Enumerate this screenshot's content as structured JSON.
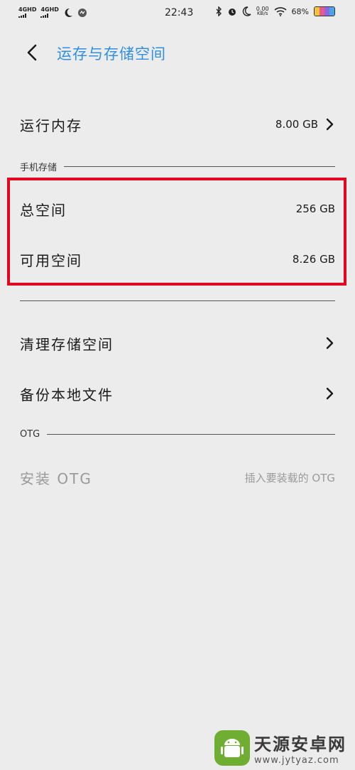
{
  "status_bar": {
    "net1": "4GHD",
    "net2": "4GHD",
    "time": "22:43",
    "speed_value": "0.00",
    "speed_unit": "KB/s",
    "battery": "68%",
    "battery_level": 0.68
  },
  "header": {
    "title": "运存与存储空间"
  },
  "ram": {
    "label": "运行内存",
    "value": "8.00 GB"
  },
  "phone_storage": {
    "section_title": "手机存储",
    "total_label": "总空间",
    "total_value": "256 GB",
    "available_label": "可用空间",
    "available_value": "8.26 GB"
  },
  "actions": {
    "clean_label": "清理存储空间",
    "backup_label": "备份本地文件"
  },
  "otg": {
    "section_title": "OTG",
    "install_label": "安装 OTG",
    "install_hint": "插入要装载的 OTG"
  },
  "watermark": {
    "title": "天源安卓网",
    "url": "www.jytyaz.com"
  },
  "colors": {
    "accent": "#2f8fe0",
    "highlight": "#e3061e",
    "background": "#ececec"
  }
}
